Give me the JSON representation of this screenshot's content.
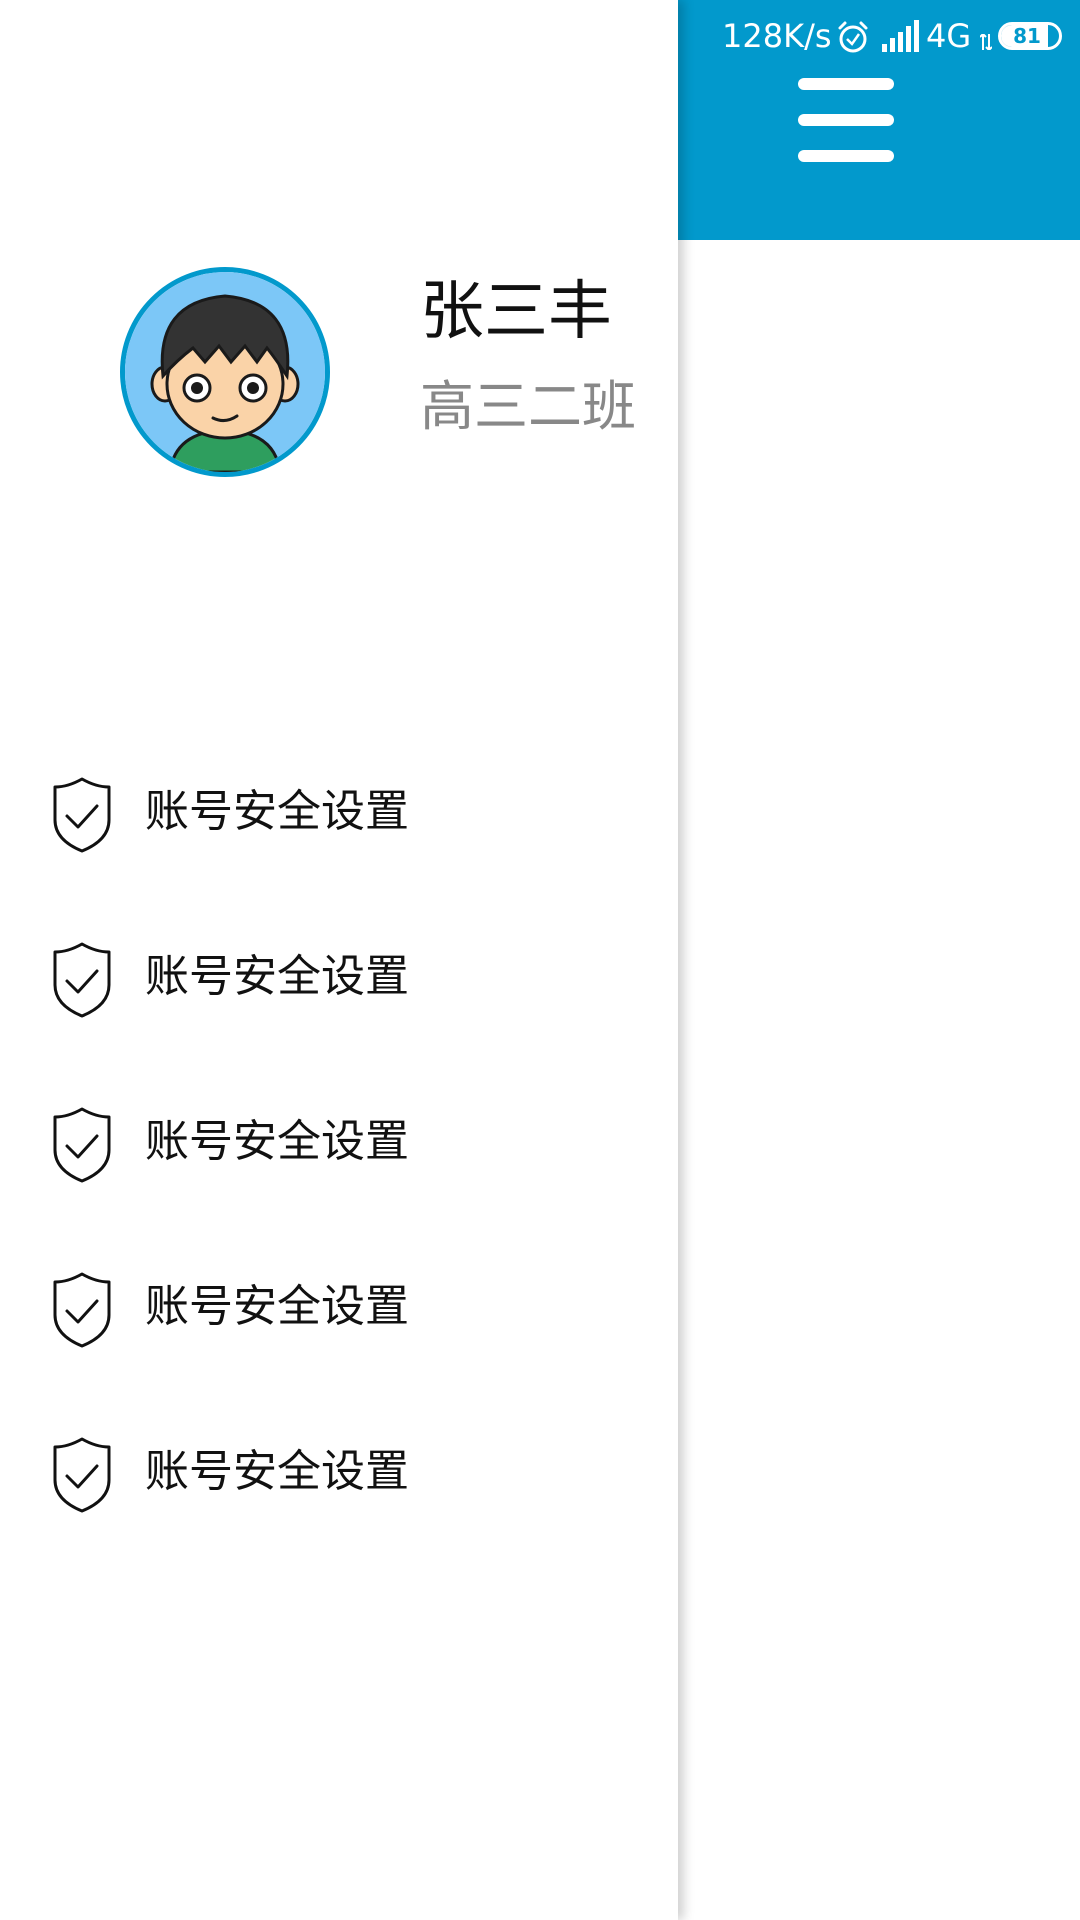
{
  "status_bar": {
    "speed": "128K/s",
    "network": "4G",
    "battery": "81",
    "battery_level": 0.81,
    "icons": [
      "alarm-icon",
      "signal-icon",
      "network-arrows-icon"
    ]
  },
  "header": {
    "menu_icon": "hamburger-menu-icon",
    "color": "#0299CC"
  },
  "profile": {
    "name": "张三丰",
    "class_name": "高三二班",
    "avatar_icon": "avatar-boy-cartoon"
  },
  "menu": {
    "items": [
      {
        "label": "账号安全设置",
        "icon": "shield-check-icon"
      },
      {
        "label": "账号安全设置",
        "icon": "shield-check-icon"
      },
      {
        "label": "账号安全设置",
        "icon": "shield-check-icon"
      },
      {
        "label": "账号安全设置",
        "icon": "shield-check-icon"
      },
      {
        "label": "账号安全设置",
        "icon": "shield-check-icon"
      }
    ]
  }
}
